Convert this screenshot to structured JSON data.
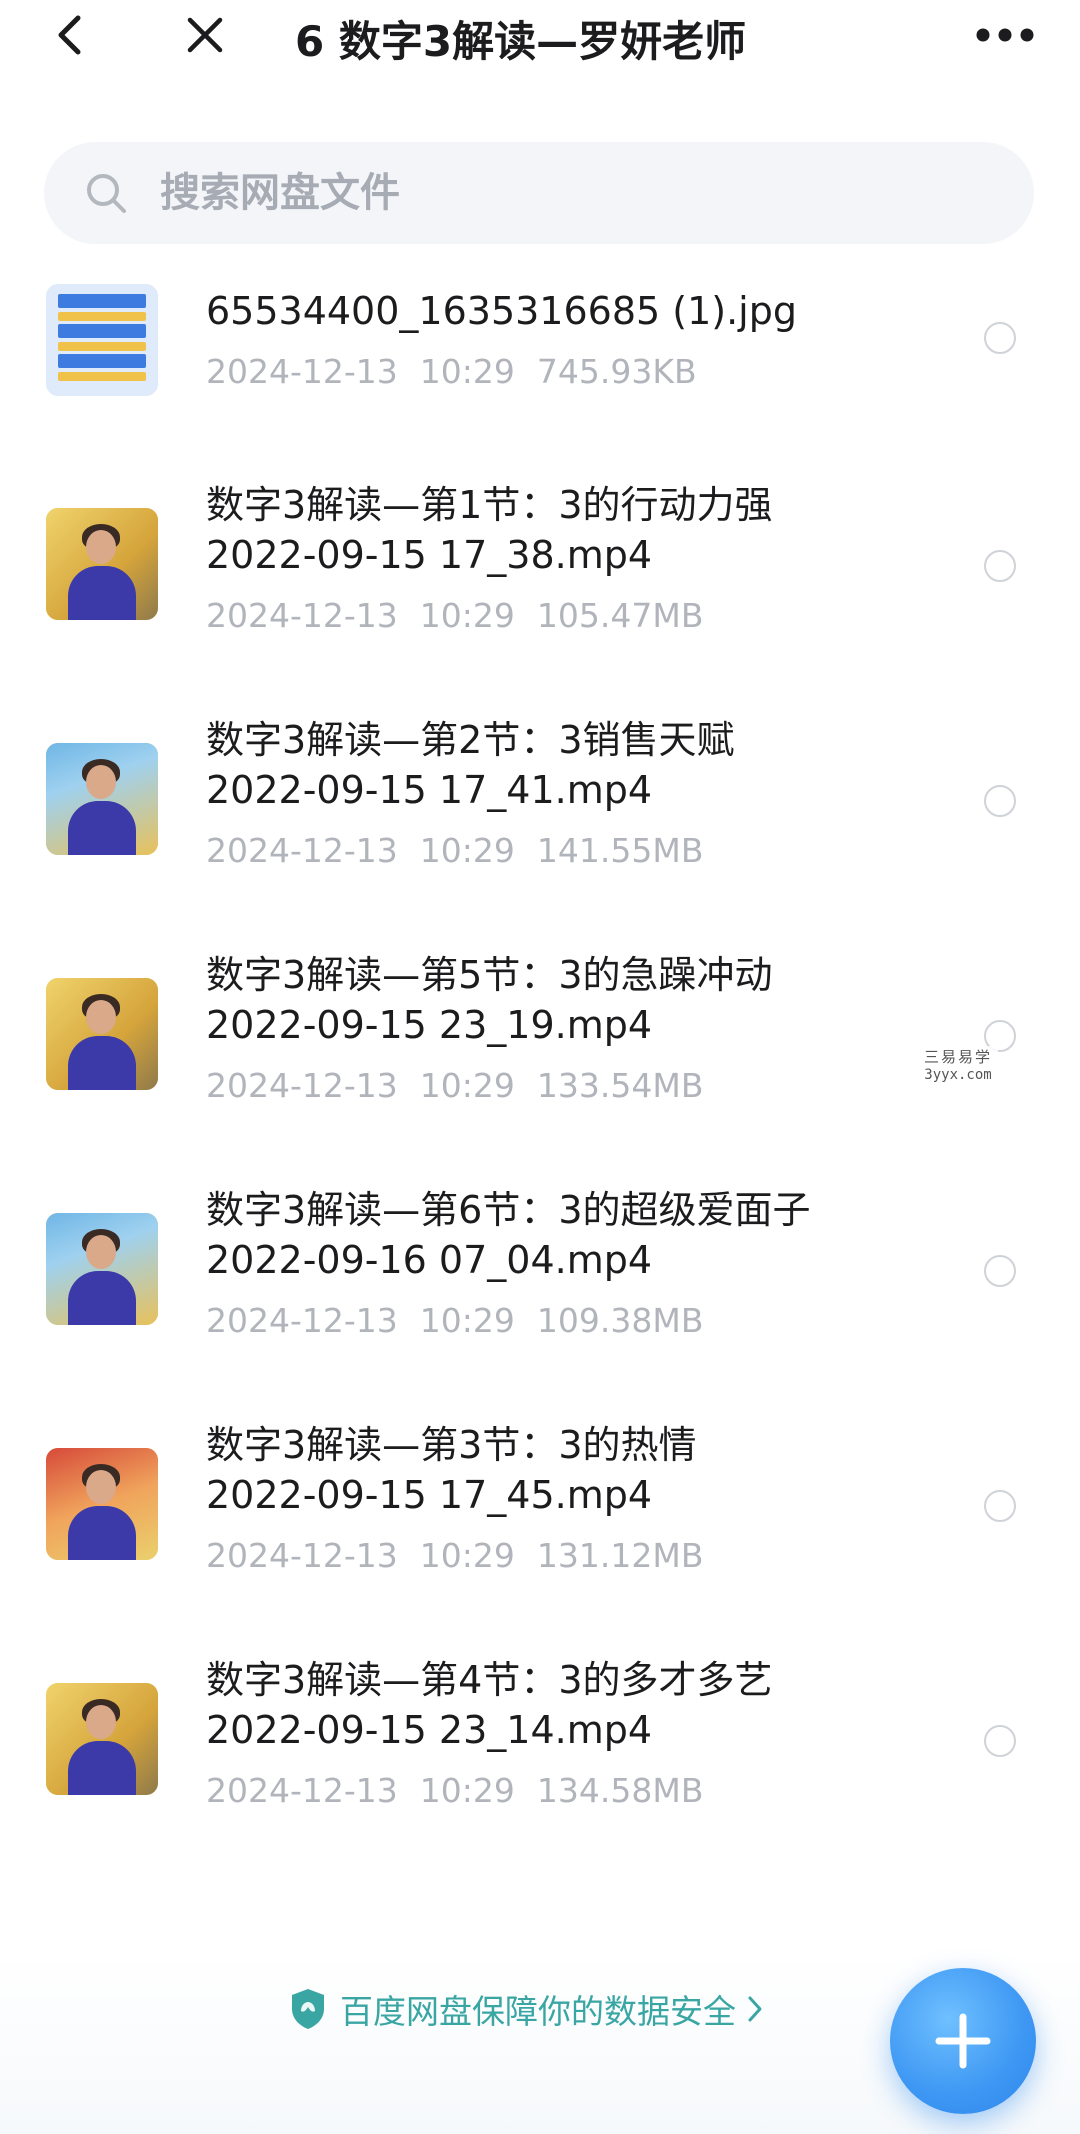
{
  "header": {
    "title": "6 数字3解读—罗妍老师",
    "back_icon": "chevron-left-icon",
    "close_icon": "close-icon",
    "more_icon": "more-horizontal-icon"
  },
  "search": {
    "placeholder": "搜索网盘文件",
    "icon": "search-icon"
  },
  "files": [
    {
      "name_line1": "65534400_1635316685 (1).jpg",
      "name_line2": "",
      "date": "2024-12-13",
      "time": "10:29",
      "size": "745.93KB",
      "type": "image"
    },
    {
      "name_line1": "数字3解读—第1节：3的行动力强",
      "name_line2": "2022-09-15 17_38.mp4",
      "date": "2024-12-13",
      "time": "10:29",
      "size": "105.47MB",
      "type": "video"
    },
    {
      "name_line1": "数字3解读—第2节：3销售天赋",
      "name_line2": "2022-09-15 17_41.mp4",
      "date": "2024-12-13",
      "time": "10:29",
      "size": "141.55MB",
      "type": "video"
    },
    {
      "name_line1": "数字3解读—第5节：3的急躁冲动",
      "name_line2": "2022-09-15 23_19.mp4",
      "date": "2024-12-13",
      "time": "10:29",
      "size": "133.54MB",
      "type": "video"
    },
    {
      "name_line1": "数字3解读—第6节：3的超级爱面子",
      "name_line2": "2022-09-16 07_04.mp4",
      "date": "2024-12-13",
      "time": "10:29",
      "size": "109.38MB",
      "type": "video"
    },
    {
      "name_line1": "数字3解读—第3节：3的热情",
      "name_line2": "2022-09-15 17_45.mp4",
      "date": "2024-12-13",
      "time": "10:29",
      "size": "131.12MB",
      "type": "video"
    },
    {
      "name_line1": "数字3解读—第4节：3的多才多艺",
      "name_line2": "2022-09-15 23_14.mp4",
      "date": "2024-12-13",
      "time": "10:29",
      "size": "134.58MB",
      "type": "video"
    }
  ],
  "footer": {
    "security_text": "百度网盘保障你的数据安全",
    "security_icon": "shield-icon",
    "add_icon": "plus-icon"
  },
  "watermark": {
    "cn": "三易易学",
    "url": "3yyx.com"
  },
  "colors": {
    "accent": "#3d97f3",
    "security_green": "#3aa6a4",
    "meta_gray": "#b1b5bb"
  }
}
